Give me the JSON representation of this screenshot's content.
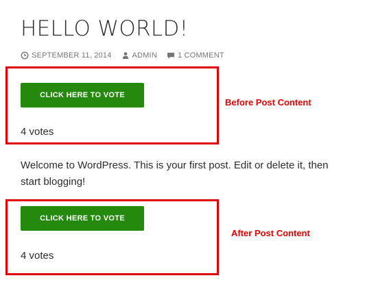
{
  "post": {
    "title": "HELLO WORLD!",
    "meta": {
      "date": "SEPTEMBER 11, 2014",
      "author": "ADMIN",
      "comments": "1 COMMENT"
    },
    "content": "Welcome to WordPress. This is your first post. Edit or delete it, then start blogging!"
  },
  "vote_before": {
    "button_label": "CLICK HERE TO VOTE",
    "votes_text": "4 votes"
  },
  "vote_after": {
    "button_label": "CLICK HERE TO VOTE",
    "votes_text": "4 votes"
  },
  "annotations": {
    "before": "Before Post Content",
    "after": "After Post Content"
  },
  "icons": {
    "date": "clock-icon",
    "author": "user-icon",
    "comments": "comment-icon"
  },
  "colors": {
    "button": "#24890d",
    "annotation": "#e10000",
    "text": "#2b2b2b",
    "meta": "#767676"
  }
}
